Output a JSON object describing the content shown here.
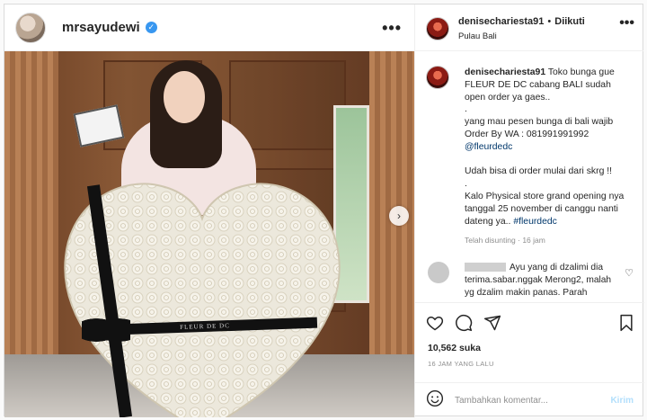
{
  "left_header": {
    "username": "mrsayudewi",
    "menu_icon": "more-horizontal-icon"
  },
  "photo": {
    "ribbon_text": "FLEUR DE DC",
    "next_icon": "chevron-right-icon"
  },
  "post_header": {
    "username": "denisechariesta91",
    "separator": "•",
    "follow_status": "Diikuti",
    "location": "Pulau Bali",
    "menu_icon": "more-horizontal-icon"
  },
  "caption": {
    "username": "denisechariesta91",
    "lines": [
      "Toko bunga gue",
      "FLEUR DE DC cabang BALI sudah",
      "open order ya gaes..",
      ".",
      "yang mau pesen bunga di bali wajib",
      "Order By WA : 081991991992",
      "@fleurdedc",
      "",
      "Udah bisa di order mulai dari skrg !!",
      ".",
      "Kalo Physical store grand opening nya",
      "tanggal 25 november di canggu nanti",
      "dateng ya.. #fleurdedc"
    ],
    "meta_edited": "Telah disunting",
    "meta_sep": "·",
    "meta_time": "16 jam"
  },
  "comment": {
    "text_line1": "Ayu yang di dzalimi dia",
    "text_line2": "terima.sabar.nggak Merong2, malah",
    "text_line3": "yg dzalim makin panas. Parah"
  },
  "actions": {
    "icons": [
      "heart-icon",
      "comment-icon",
      "share-icon",
      "bookmark-icon"
    ]
  },
  "likes": "10,562 suka",
  "timestamp": "16 JAM YANG LALU",
  "add_comment": {
    "placeholder": "Tambahkan komentar...",
    "post_label": "Kirim"
  },
  "colors": {
    "verified": "#3897f0",
    "link": "#00376b",
    "muted": "#8e8e8e",
    "post_button_disabled": "#b2dffc"
  }
}
